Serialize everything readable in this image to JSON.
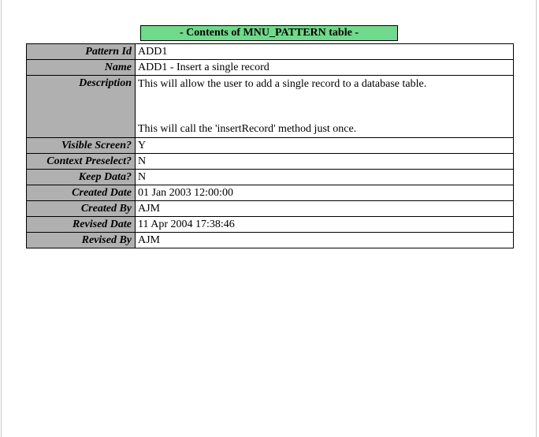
{
  "banner": {
    "title": "- Contents of MNU_PATTERN table -",
    "background_color": "#71d98b",
    "border_color": "#000000"
  },
  "table": {
    "label_background_color": "#b0b0b0",
    "border_color": "#000000",
    "rows": [
      {
        "label": "Pattern Id",
        "value": "ADD1"
      },
      {
        "label": "Name",
        "value": "ADD1 - Insert a single record"
      },
      {
        "label": "Description",
        "value": "This will allow the user to add a single record to a database table.\n\n\nThis will call the 'insertRecord' method just once."
      },
      {
        "label": "Visible Screen?",
        "value": "Y"
      },
      {
        "label": "Context Preselect?",
        "value": "N"
      },
      {
        "label": "Keep Data?",
        "value": "N"
      },
      {
        "label": "Created Date",
        "value": "01 Jan 2003 12:00:00"
      },
      {
        "label": "Created By",
        "value": "AJM"
      },
      {
        "label": "Revised Date",
        "value": "11 Apr 2004 17:38:46"
      },
      {
        "label": "Revised By",
        "value": "AJM"
      }
    ]
  }
}
